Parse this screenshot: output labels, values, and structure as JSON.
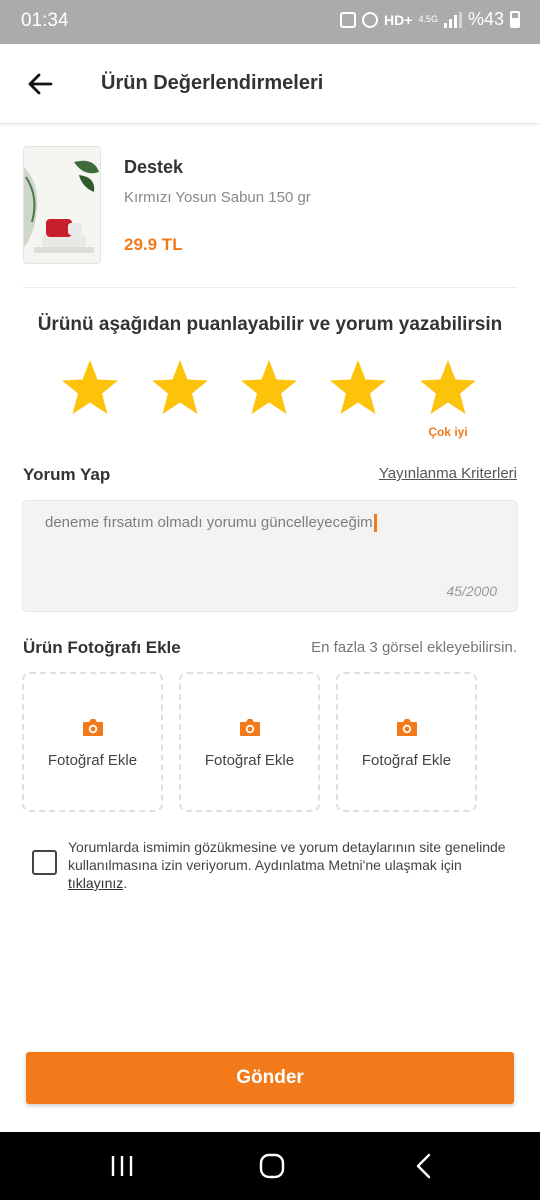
{
  "status_bar": {
    "time": "01:34",
    "network": "HD+",
    "network_gen": "4.5G",
    "battery": "%43"
  },
  "header": {
    "title": "Ürün Değerlendirmeleri",
    "back_icon": "arrow-left-icon"
  },
  "product": {
    "brand": "Destek",
    "name": "Kırmızı Yosun Sabun 150 gr",
    "price": "29.9 TL"
  },
  "rating": {
    "prompt": "Ürünü aşağıdan puanlayabilir ve yorum yazabilirsin",
    "value": 5,
    "max": 5,
    "caption": "Çok iyi",
    "star_color": "#fdc20a"
  },
  "review": {
    "label": "Yorum Yap",
    "criteria_link": "Yayınlanma Kriterleri",
    "text": "deneme fırsatım olmadı yorumu güncelleyeceğim",
    "counter": "45/2000"
  },
  "photos": {
    "label": "Ürün Fotoğrafı Ekle",
    "hint": "En fazla 3 görsel ekleyebilirsin.",
    "slots": [
      {
        "label": "Fotoğraf Ekle"
      },
      {
        "label": "Fotoğraf Ekle"
      },
      {
        "label": "Fotoğraf Ekle"
      }
    ]
  },
  "consent": {
    "checked": false,
    "text": "Yorumlarda ismimin gözükmesine ve yorum detaylarının site genelinde kullanılmasına izin veriyorum. Aydınlatma Metni'ne ulaşmak için ",
    "link": "tıklayınız",
    "suffix": "."
  },
  "submit": {
    "label": "Gönder"
  },
  "colors": {
    "accent": "#f27a1a",
    "star": "#fdc20a"
  }
}
